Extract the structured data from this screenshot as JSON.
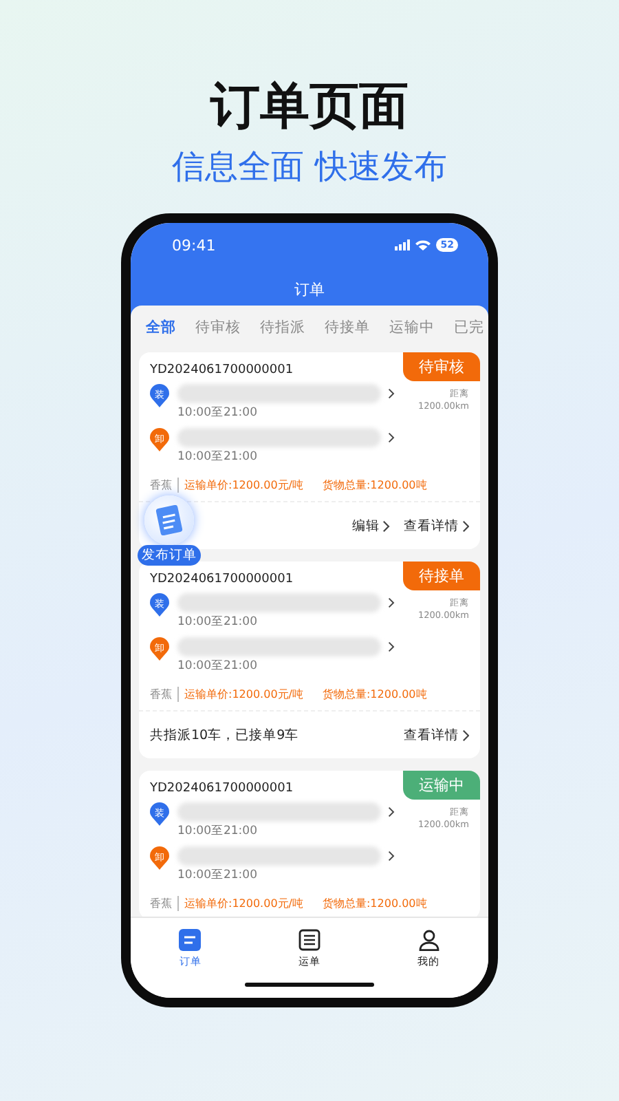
{
  "headline": {
    "title": "订单页面",
    "subtitle": "信息全面 快速发布"
  },
  "status_bar": {
    "time": "09:41",
    "battery": "52"
  },
  "header": {
    "title": "订单"
  },
  "tabs": [
    {
      "label": "全部",
      "selected": true
    },
    {
      "label": "待审核",
      "selected": false
    },
    {
      "label": "待指派",
      "selected": false
    },
    {
      "label": "待接单",
      "selected": false
    },
    {
      "label": "运输中",
      "selected": false
    },
    {
      "label": "已完",
      "selected": false
    }
  ],
  "orders": [
    {
      "order_no": "YD2024061700000001",
      "status": {
        "label": "待审核",
        "color": "#f26a0a"
      },
      "stops": [
        {
          "kind": "load",
          "label": "装",
          "time": "10:00至21:00"
        },
        {
          "kind": "unload",
          "label": "卸",
          "time": "10:00至21:00"
        }
      ],
      "distance_label": "距离",
      "distance": "1200.00km",
      "cargo": "香蕉",
      "price": "运输单价:1200.00元/吨",
      "weight": "货物总量:1200.00吨",
      "footer": {
        "actions": [
          "编辑",
          "查看详情"
        ]
      }
    },
    {
      "order_no": "YD2024061700000001",
      "status": {
        "label": "待接单",
        "color": "#f26a0a"
      },
      "stops": [
        {
          "kind": "load",
          "label": "装",
          "time": "10:00至21:00"
        },
        {
          "kind": "unload",
          "label": "卸",
          "time": "10:00至21:00"
        }
      ],
      "distance_label": "距离",
      "distance": "1200.00km",
      "cargo": "香蕉",
      "price": "运输单价:1200.00元/吨",
      "weight": "货物总量:1200.00吨",
      "footer": {
        "summary": "共指派10车，已接单9车",
        "actions": [
          "查看详情"
        ]
      }
    },
    {
      "order_no": "YD2024061700000001",
      "status": {
        "label": "运输中",
        "color": "#4caf78"
      },
      "stops": [
        {
          "kind": "load",
          "label": "装",
          "time": "10:00至21:00"
        },
        {
          "kind": "unload",
          "label": "卸",
          "time": "10:00至21:00"
        }
      ],
      "distance_label": "距离",
      "distance": "1200.00km",
      "cargo": "香蕉",
      "price": "运输单价:1200.00元/吨",
      "weight": "货物总量:1200.00吨"
    }
  ],
  "fab": {
    "label": "发布订单"
  },
  "bottom_nav": [
    {
      "kind": "orders",
      "label": "订单",
      "selected": true
    },
    {
      "kind": "waybill",
      "label": "运单",
      "selected": false
    },
    {
      "kind": "profile",
      "label": "我的",
      "selected": false
    }
  ]
}
